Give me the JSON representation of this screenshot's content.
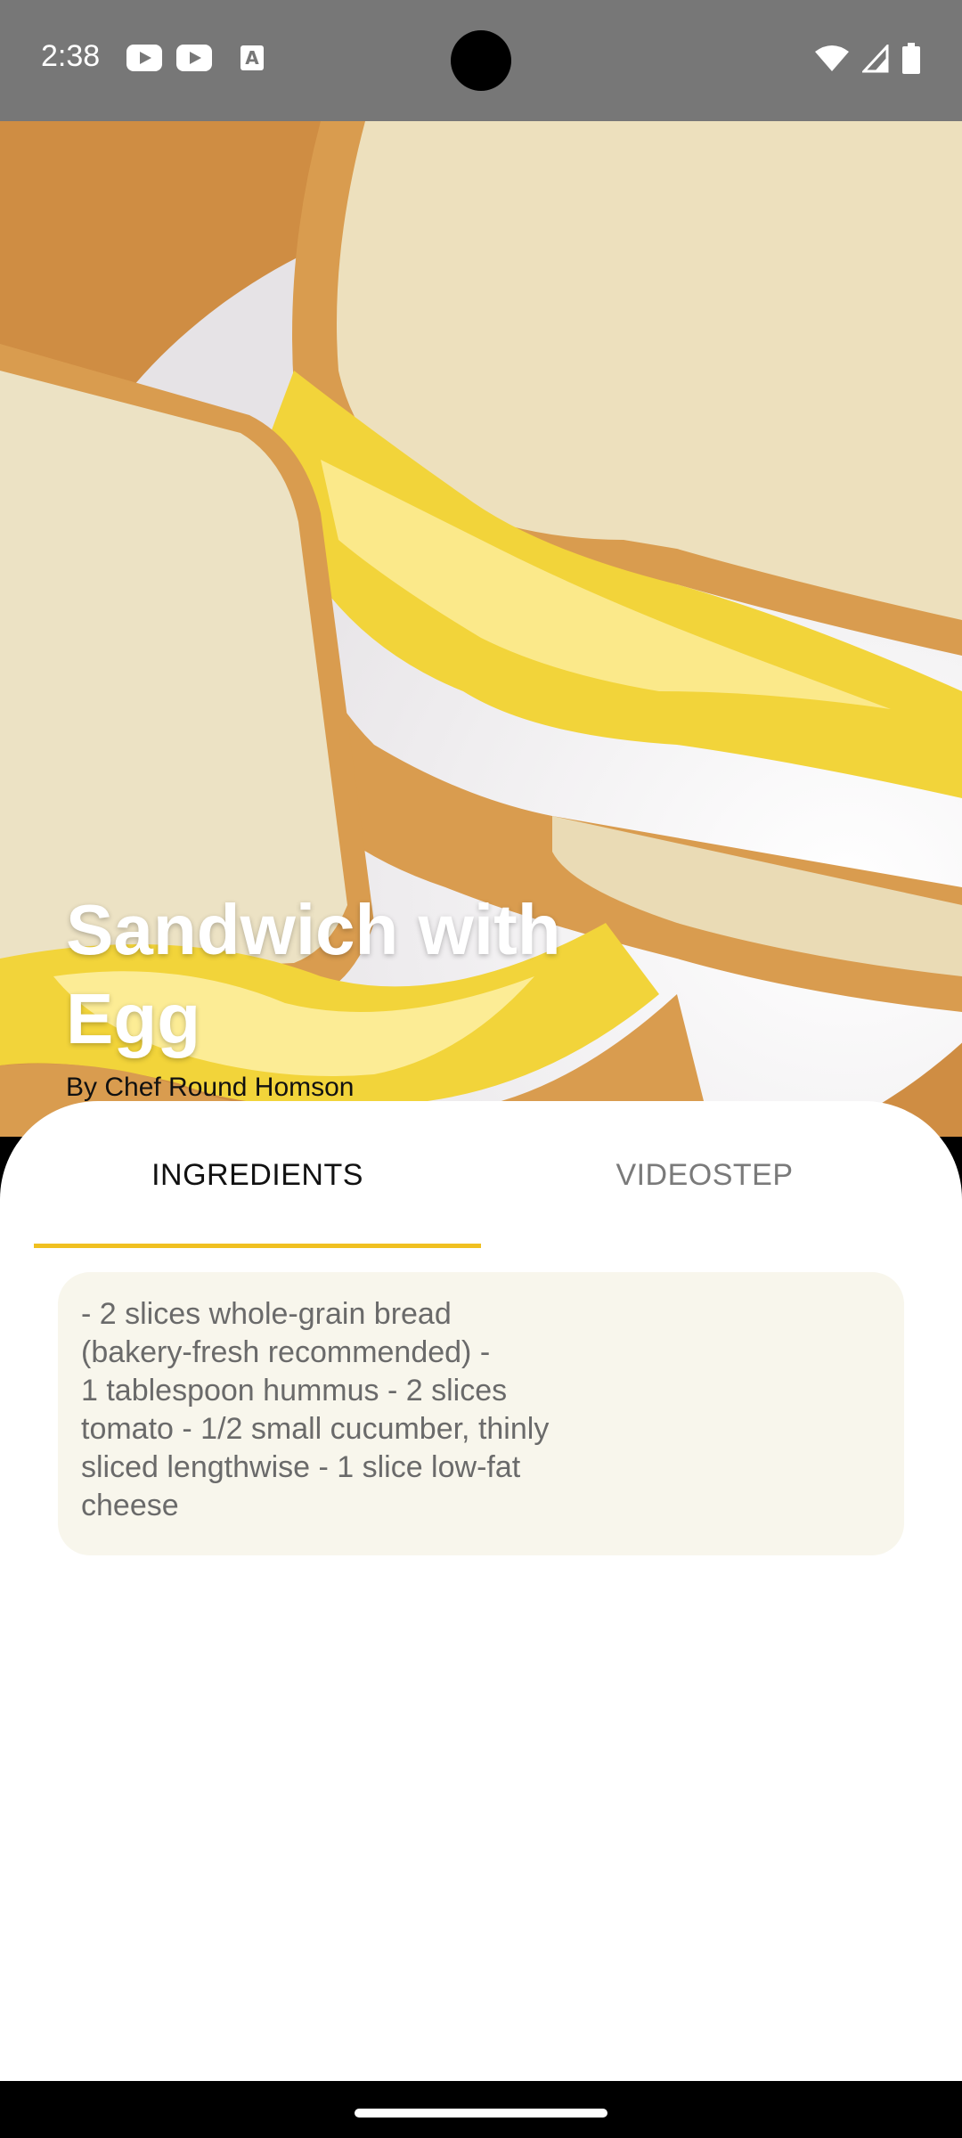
{
  "status_bar": {
    "time": "2:38",
    "left_icons": [
      "youtube-icon",
      "youtube-icon",
      "text-a-icon"
    ],
    "right_icons": [
      "wifi-icon",
      "signal-icon",
      "battery-icon"
    ],
    "a_glyph": "A"
  },
  "recipe": {
    "title": "Sandwich with Egg",
    "author": "By Chef Round Homson"
  },
  "tabs": [
    {
      "label": "INGREDIENTS",
      "selected": true
    },
    {
      "label": "VIDEOSTEP",
      "selected": false
    }
  ],
  "ingredients": {
    "text": "- 2 slices whole-grain bread\n(bakery-fresh recommended) -\n1 tablespoon hummus - 2 slices\ntomato - 1/2 small cucumber, thinly\nsliced lengthwise - 1 slice low-fat\ncheese"
  },
  "colors": {
    "status_bar": "#777777",
    "tab_indicator": "#f0c020",
    "card_background": "#f8f6ec",
    "sheet_background": "#ffffff"
  }
}
